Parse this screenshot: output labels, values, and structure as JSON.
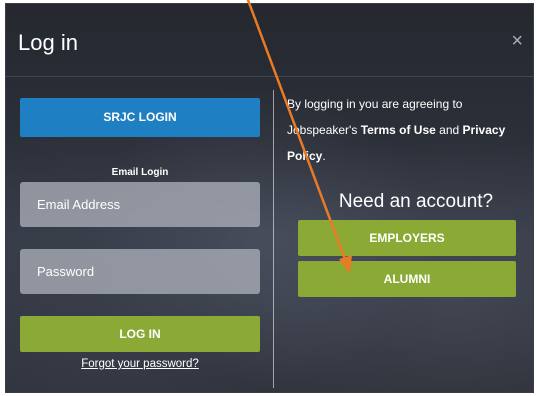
{
  "header": {
    "title": "Log in",
    "close_glyph": "×"
  },
  "left": {
    "sso_button_label": "SRJC LOGIN",
    "email_login_label": "Email Login",
    "email_placeholder": "Email Address",
    "password_placeholder": "Password",
    "login_button_label": "LOG IN",
    "forgot_link": "Forgot your password?"
  },
  "right": {
    "terms_prefix": "By logging in you are agreeing to Jobspeaker's",
    "terms_link": "Terms of Use",
    "terms_and": "and",
    "privacy_link": "Privacy Policy",
    "terms_suffix": ".",
    "need_account": "Need an account?",
    "employers_button_label": "EMPLOYERS",
    "alumni_button_label": "ALUMNI"
  },
  "colors": {
    "sso_button": "#1e7fc2",
    "green_button": "#8aaa35",
    "annotation_arrow": "#e87b24"
  },
  "icons": {
    "close": "close-icon",
    "annotation": "annotation-arrow"
  }
}
